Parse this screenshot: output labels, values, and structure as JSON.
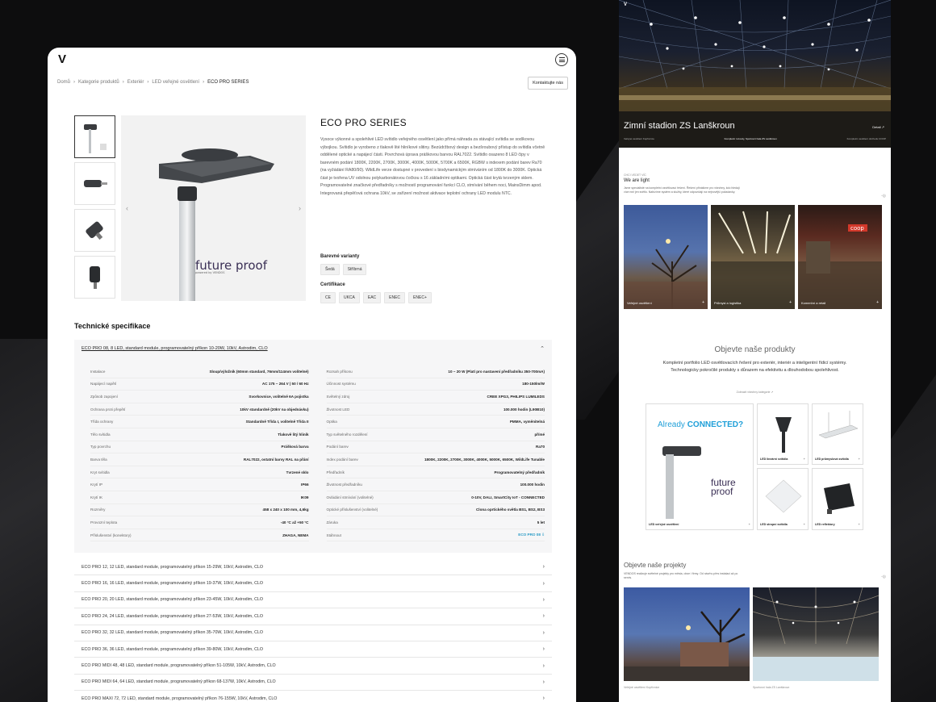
{
  "left": {
    "logo": "V",
    "breadcrumb": [
      "Domů",
      "Kategorie produktů",
      "Exteriér",
      "LED veřejné osvětlení",
      "ECO PRO SERIES"
    ],
    "contact_label": "Kontaktujte nás",
    "product_title": "ECO PRO SERIES",
    "description": "Vysoce výkonné a spolehlivé LED svítidlo veřejného osvětlení jako přímá náhrada za stávající svítidla se sodíkovou výbojkou. Svítidlo je vyrobeno z tlakově lité hliníkové slitiny. Bezúdržbový design a bezšroubový přístup do svítidla včetně oddělené optické a napájecí části. Povrchová úprava práškovou barvou RAL7022. Svítidlo osazeno 8 LED čipy v barevném podání 1800K, 2200K, 2700K, 3000K, 4000K, 5000K, 5700K a 6500K, RGBW s indexem podání barev Ra70 (na vyžádání RA80/90). WildLife verze dostupné v provedení s biodynamickým stmíváním od 1800K do 3000K. Optická část je tvořena UV odolnou polykarbonátovou čočkou s 16 základními optikami. Optická část krytá tvrzeným sklem. Programovatelné značkové předřadníky s možností programování funkcí CLO, stmívání během noci, MainsDimm apod. Integrovaná přepěťová ochrana 10kV, se zařízení možnost aktivace teplotní ochrany LED modulu NTC.",
    "color_label": "Barevné varianty",
    "colors": [
      "Šedá",
      "Stříbrná"
    ],
    "cert_label": "Certifikace",
    "certs": [
      "CE",
      "UKCA",
      "EAC",
      "ENEC",
      "ENEC+"
    ],
    "future_proof": "future proof",
    "future_proof_small": "powered by VENDOS",
    "tech_title": "Technické specifikace",
    "open_module": "ECO PRO 08, 8 LED, standard module, programovatelný příkon 10-20W, 10kV, Astrodim, CLO",
    "specs_left": [
      {
        "k": "Instalace",
        "v": "Sloup/výložník (60mm standard, 76mm/114mm volitelné)"
      },
      {
        "k": "Napájecí napětí",
        "v": "AC 175 ~ 264 V | 50 / 60 Hz"
      },
      {
        "k": "Způsob zapojení",
        "v": "Svorkovnice, volitelně 6A pojistka"
      },
      {
        "k": "Ochrana proti přepětí",
        "v": "10kV standardně (20kV na objednávku)"
      },
      {
        "k": "Třída ochrany",
        "v": "Standardně Třída I, volitelně Třída II"
      },
      {
        "k": "Tělo svítidla",
        "v": "Tlakově litý hliník"
      },
      {
        "k": "Typ povrchu",
        "v": "Prášková barva"
      },
      {
        "k": "Barva těla",
        "v": "RAL7022, ostatní barvy RAL na přání"
      },
      {
        "k": "Kryt svítidla",
        "v": "Tvrzené sklo"
      },
      {
        "k": "Krytí IP",
        "v": "IP66"
      },
      {
        "k": "Krytí IK",
        "v": "IK09"
      },
      {
        "k": "Rozměry",
        "v": "458 x 240 x 100 mm, 4,6kg"
      },
      {
        "k": "Provozní teplota",
        "v": "-40 °C až +50 °C"
      },
      {
        "k": "Příslušenství (konektory)",
        "v": "ZHAGA, NEMA"
      }
    ],
    "specs_right": [
      {
        "k": "Rozsah příkonu",
        "v": "10 ~ 20 W (Platí pro nastavení předřadníku 350-700mA)"
      },
      {
        "k": "Účinnost systému",
        "v": "180-150lm/W"
      },
      {
        "k": "Světelný zdroj",
        "v": "CREE XPG3, PHILIPS LUMILEDS"
      },
      {
        "k": "Životnost LED",
        "v": "100.000 hodin (L90B10)"
      },
      {
        "k": "Optika",
        "v": "PMMA, vyměnitelná"
      },
      {
        "k": "Typ světelného rozdělení",
        "v": "přímé"
      },
      {
        "k": "Podání barev",
        "v": "Ra70"
      },
      {
        "k": "Index podání barev",
        "v": "1800K, 2200K, 2700K, 3000K, 4000K, 5000K, 6500K, WildLife Tunable"
      },
      {
        "k": "Předřadník",
        "v": "Programovatelný předřadník"
      },
      {
        "k": "Životnost předřadníku",
        "v": "100.000 hodin"
      },
      {
        "k": "Ovládání stmívání (volitelné)",
        "v": "0-10V, DALI, SmartCity IoT - CONNECTED"
      },
      {
        "k": "Optické příslušenství (volitelné)",
        "v": "Clona oprtického světla BS1, BS2, BS3"
      },
      {
        "k": "Záruka",
        "v": "5 let"
      },
      {
        "k": "Stáhnout",
        "v": "ECO PRO 08 ⇩"
      }
    ],
    "modules": [
      "ECO PRO 12, 12 LED, standard module, programovatelný příkon 15-29W, 10kV, Astrodim, CLO",
      "ECO PRO 16, 16 LED, standard module, programovatelný příkon 19-37W, 10kV, Astrodim, CLO",
      "ECO PRO 20, 20 LED, standard module, programovatelný příkon 23-45W, 10kV, Astrodim, CLO",
      "ECO PRO 24, 24 LED, standard module, programovatelný příkon 27-53W, 10kV, Astrodim, CLO",
      "ECO PRO 32, 32 LED, standard module, programovatelný příkon 35-70W, 10kV, Astrodim, CLO",
      "ECO PRO 36, 36 LED, standard module, programovatelný příkon 39-80W, 10kV, Astrodim, CLO",
      "ECO PRO MIDI 48, 48 LED, standard module, programovatelný příkon 51-105W, 10kV, Astrodim, CLO",
      "ECO PRO MIDI 64, 64 LED, standard module, programovatelný příkon 68-137W, 10kV, Astrodim, CLO",
      "ECO PRO MAXI 72, 72 LED, standard module, programovatelný příkon 76-155W, 10kV, Astrodim, CLO"
    ]
  },
  "right": {
    "logo": "V",
    "hero_title": "Zimní stadion ZS Lanškroun",
    "hero_more": "Detail ↗",
    "hero_tabs": [
      "Veřejné osvětlení Kopřivnice",
      "Kompletní rozvody, Sportovní hala ZS Lanškroun",
      "Kompletní osvětlení obchodu COOP"
    ],
    "about_small": "CHCI VEDET VÍC",
    "about_title": "We are light",
    "about_text": "Jsme specialisté na kompletní osvětlovací řešení. Řešení přinášíme pro všechny, kdo hledají více než jen světlo. Nabízíme systém a služby, které odpovídají na nejnovější požadavky.",
    "cards": [
      "Veřejné osvětlení",
      "Průmysl a logistika",
      "Komerční a retail"
    ],
    "products_title": "Objevte naše produkty",
    "products_text": "Kompletní portfolio LED osvětlovacích řešení pro exteriér, interiér a inteligentní řídicí systémy. Technologicky pokročilé produkty s důrazem na efektivitu a dlouhodobou spolehlivost.",
    "products_link": "Zobrazit všechny kategorie ↗",
    "connected_a": "Already ",
    "connected_b": "CONNECTED?",
    "product_cards": [
      "LED veřejné osvětlení",
      "LED lineární svítidla",
      "LED průmyslová svítidla",
      "LED stropní svítidla",
      "LED reflektory"
    ],
    "projects_title": "Objevte naše projekty",
    "projects_text": "VENDOS realizuje světelné projekty pro města, obce i firmy. Od návrhu přes instalaci až po servis.",
    "project_caps": [
      "Veřejné osvětlení Kopřivnice",
      "Sportovní hala ZS Lanškroun"
    ]
  },
  "colors": {
    "accent": "#2a9bc6",
    "connected": "#1f9fd8",
    "purple": "#3a2f55"
  }
}
